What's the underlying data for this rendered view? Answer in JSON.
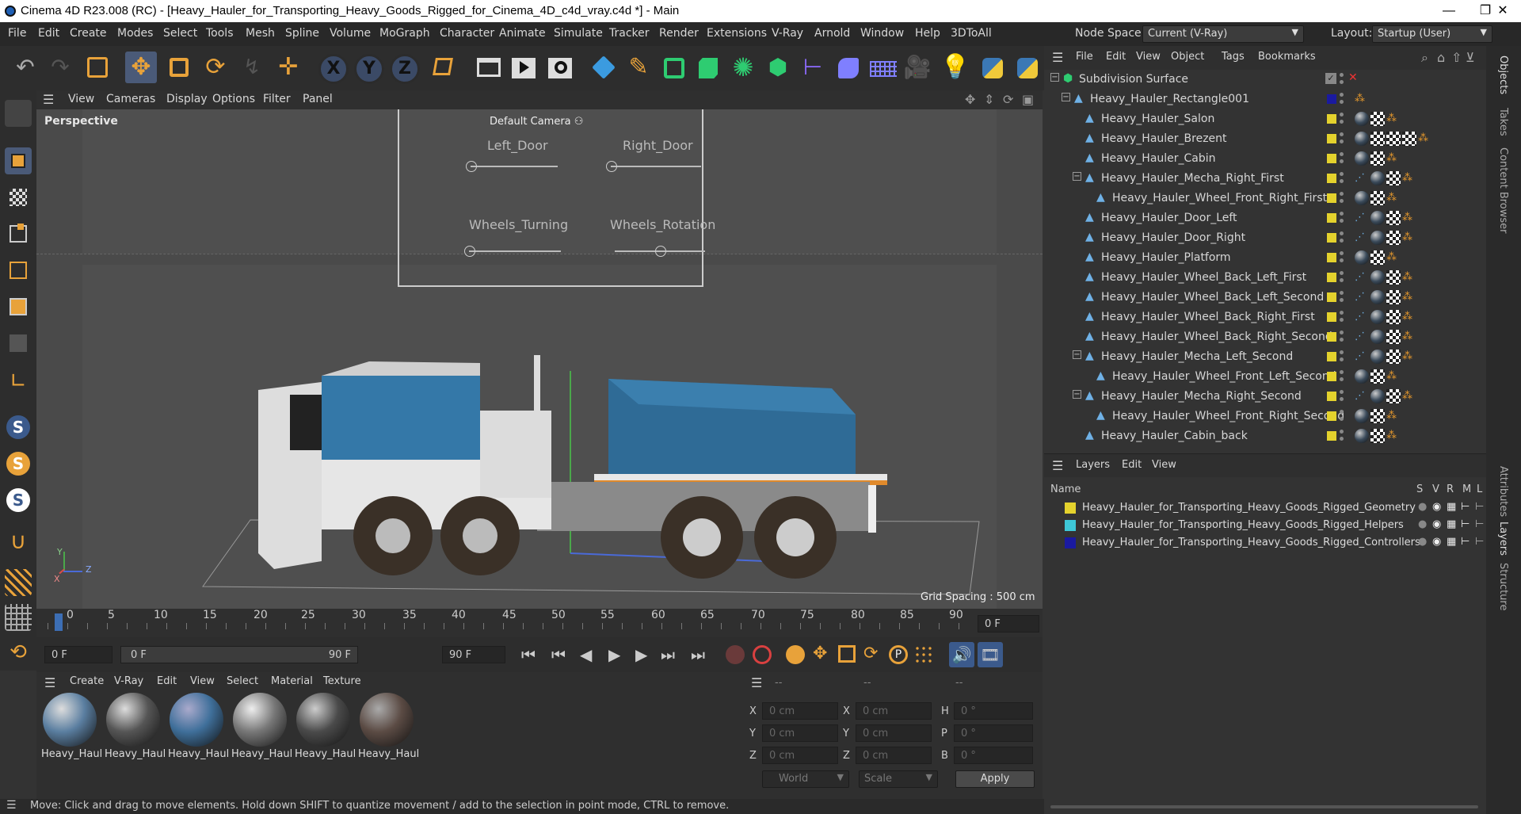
{
  "window": {
    "title": "Cinema 4D R23.008 (RC) - [Heavy_Hauler_for_Transporting_Heavy_Goods_Rigged_for_Cinema_4D_c4d_vray.c4d *] - Main",
    "min": "—",
    "max": "❐",
    "close": "✕"
  },
  "menu": [
    "File",
    "Edit",
    "Create",
    "Modes",
    "Select",
    "Tools",
    "Mesh",
    "Spline",
    "Volume",
    "MoGraph",
    "Character",
    "Animate",
    "Simulate",
    "Tracker",
    "Render",
    "Extensions",
    "V-Ray",
    "Arnold",
    "Window",
    "Help",
    "3DToAll"
  ],
  "node_space": {
    "label": "Node Space:",
    "value": "Current (V-Ray)"
  },
  "layout": {
    "label": "Layout:",
    "value": "Startup (User)"
  },
  "toolbar": {
    "x": "X",
    "y": "Y",
    "z": "Z"
  },
  "viewport": {
    "menu": [
      "View",
      "Cameras",
      "Display",
      "Options",
      "Filter",
      "Panel"
    ],
    "label": "Perspective",
    "camera": "Default Camera",
    "grid_spacing": "Grid Spacing : 500 cm",
    "sliders": [
      {
        "label": "Left_Door",
        "value": 0.0
      },
      {
        "label": "Right_Door",
        "value": 0.0
      },
      {
        "label": "Wheels_Turning",
        "value": 0.0
      },
      {
        "label": "Wheels_Rotation",
        "value": 0.5
      }
    ],
    "axis": {
      "x": "X",
      "y": "Y",
      "z": "Z"
    }
  },
  "timeline": {
    "ticks": [
      "0",
      "5",
      "10",
      "15",
      "20",
      "25",
      "30",
      "35",
      "40",
      "45",
      "50",
      "55",
      "60",
      "65",
      "70",
      "75",
      "80",
      "85",
      "90"
    ],
    "current": "0 F"
  },
  "playback": {
    "start": "0 F",
    "range_start": "0 F",
    "range_end": "90 F",
    "end": "90 F"
  },
  "material_panel": {
    "menu": [
      "Create",
      "V-Ray",
      "Edit",
      "View",
      "Select",
      "Material",
      "Texture"
    ],
    "materials": [
      {
        "label": "Heavy_Haul",
        "color": "#5a7ea0"
      },
      {
        "label": "Heavy_Haul",
        "color": "#555"
      },
      {
        "label": "Heavy_Haul",
        "color": "#3f6f9a"
      },
      {
        "label": "Heavy_Haul",
        "color": "#777"
      },
      {
        "label": "Heavy_Haul",
        "color": "#4a4a4a"
      },
      {
        "label": "Heavy_Haul",
        "color": "#5b4b44"
      }
    ]
  },
  "coords": {
    "headers": [
      "--",
      "--",
      "--"
    ],
    "rows": [
      {
        "a": "X",
        "av": "0 cm",
        "b": "X",
        "bv": "0 cm",
        "c": "H",
        "cv": "0 °"
      },
      {
        "a": "Y",
        "av": "0 cm",
        "b": "Y",
        "bv": "0 cm",
        "c": "P",
        "cv": "0 °"
      },
      {
        "a": "Z",
        "av": "0 cm",
        "b": "Z",
        "bv": "0 cm",
        "c": "B",
        "cv": "0 °"
      }
    ],
    "space": "World",
    "mode": "Scale",
    "apply": "Apply"
  },
  "status": "Move: Click and drag to move elements. Hold down SHIFT to quantize movement / add to the selection in point mode, CTRL to remove.",
  "object_manager": {
    "menu": [
      "File",
      "Edit",
      "View",
      "Object",
      "Tags",
      "Bookmarks"
    ],
    "objects": [
      {
        "name": "Subdivision Surface",
        "indent": 0
      },
      {
        "name": "Heavy_Hauler_Rectangle001",
        "indent": 1
      },
      {
        "name": "Heavy_Hauler_Salon",
        "indent": 2
      },
      {
        "name": "Heavy_Hauler_Brezent",
        "indent": 2
      },
      {
        "name": "Heavy_Hauler_Cabin",
        "indent": 2
      },
      {
        "name": "Heavy_Hauler_Mecha_Right_First",
        "indent": 2
      },
      {
        "name": "Heavy_Hauler_Wheel_Front_Right_First",
        "indent": 3
      },
      {
        "name": "Heavy_Hauler_Door_Left",
        "indent": 2
      },
      {
        "name": "Heavy_Hauler_Door_Right",
        "indent": 2
      },
      {
        "name": "Heavy_Hauler_Platform",
        "indent": 2
      },
      {
        "name": "Heavy_Hauler_Wheel_Back_Left_First",
        "indent": 2
      },
      {
        "name": "Heavy_Hauler_Wheel_Back_Left_Second",
        "indent": 2
      },
      {
        "name": "Heavy_Hauler_Wheel_Back_Right_First",
        "indent": 2
      },
      {
        "name": "Heavy_Hauler_Wheel_Back_Right_Second",
        "indent": 2
      },
      {
        "name": "Heavy_Hauler_Mecha_Left_Second",
        "indent": 2
      },
      {
        "name": "Heavy_Hauler_Wheel_Front_Left_Second",
        "indent": 3
      },
      {
        "name": "Heavy_Hauler_Mecha_Right_Second",
        "indent": 2
      },
      {
        "name": "Heavy_Hauler_Wheel_Front_Right_Second",
        "indent": 3
      },
      {
        "name": "Heavy_Hauler_Cabin_back",
        "indent": 2
      }
    ]
  },
  "layer_manager": {
    "menu": [
      "Layers",
      "Edit",
      "View"
    ],
    "columns": [
      "Name",
      "S",
      "V",
      "R",
      "M",
      "L"
    ],
    "layers": [
      {
        "name": "Heavy_Hauler_for_Transporting_Heavy_Goods_Rigged_Geometry",
        "color": "#e4d22d"
      },
      {
        "name": "Heavy_Hauler_for_Transporting_Heavy_Goods_Rigged_Helpers",
        "color": "#3ec8d8"
      },
      {
        "name": "Heavy_Hauler_for_Transporting_Heavy_Goods_Rigged_Controllers",
        "color": "#1a1aa0"
      }
    ]
  },
  "right_tabs": [
    "Objects",
    "Takes",
    "Content Browser",
    "Attributes",
    "Layers",
    "Structure"
  ]
}
